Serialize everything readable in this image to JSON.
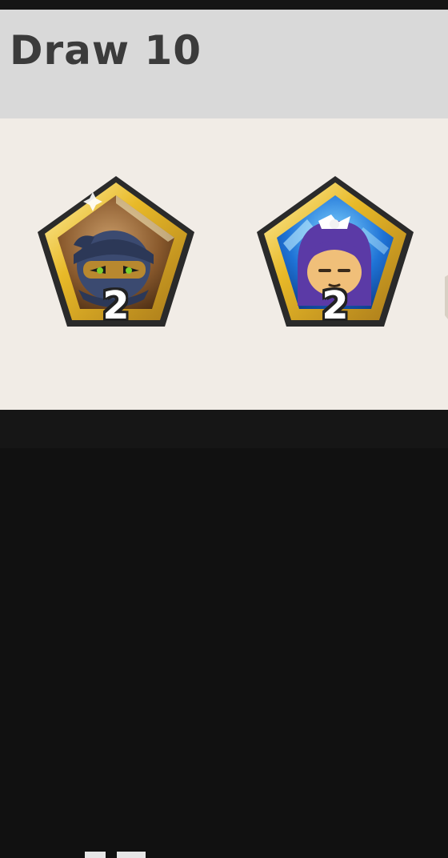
{
  "section": {
    "title": "Draw 10"
  },
  "rewards": [
    {
      "character": "ninja-cookie-soulstone-icon",
      "count": "2",
      "frame": "gold",
      "bg": "bronze"
    },
    {
      "character": "blackberry-cookie-soulstone-icon",
      "count": "2",
      "frame": "gold",
      "bg": "blue"
    }
  ],
  "colors": {
    "header_bg": "#d9d9d9",
    "panel_bg": "#f1ece6",
    "title_text": "#3b3b3b",
    "gold": "#e8b928",
    "blue_bg": "#1f73d6",
    "bronze_bg": "#8a5a2d"
  }
}
